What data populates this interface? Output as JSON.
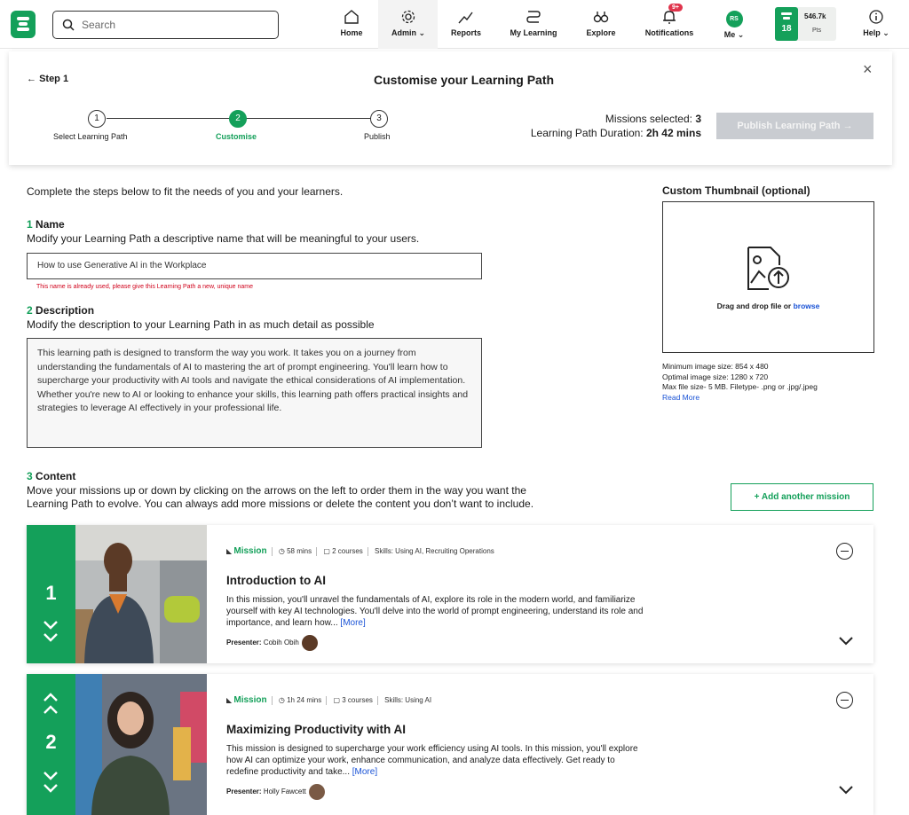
{
  "nav": {
    "search_placeholder": "Search",
    "items": [
      {
        "label": "Home"
      },
      {
        "label": "Admin"
      },
      {
        "label": "Reports"
      },
      {
        "label": "My Learning"
      },
      {
        "label": "Explore"
      },
      {
        "label": "Notifications"
      },
      {
        "label": "Me"
      },
      {
        "label": "Help"
      }
    ],
    "notifications_badge": "9+",
    "avatar_initials": "RS",
    "level": "18",
    "points": "546.7k",
    "points_label": "Pts"
  },
  "stepper": {
    "back_label": "Step 1",
    "title": "Customise your Learning Path",
    "steps": [
      {
        "num": "1",
        "label": "Select Learning Path"
      },
      {
        "num": "2",
        "label": "Customise"
      },
      {
        "num": "3",
        "label": "Publish"
      }
    ],
    "active_step": 2,
    "missions_selected_label": "Missions selected:",
    "missions_selected_value": "3",
    "duration_label": "Learning Path Duration:",
    "duration_value": "2h 42 mins",
    "publish_label": "Publish Learning Path",
    "close_glyph": "×"
  },
  "form": {
    "intro": "Complete the steps below to fit the needs of you and your learners.",
    "name": {
      "num": "1",
      "heading": "Name",
      "help": "Modify your Learning Path a descriptive name that will be meaningful to your users.",
      "value": "How to use Generative AI in the Workplace",
      "error": "This name is already used, please give this Learning Path a new, unique name"
    },
    "description": {
      "num": "2",
      "heading": "Description",
      "help": "Modify the description to your Learning Path in as much detail as possible",
      "value": "This learning path is designed to transform the way you work. It takes you on a journey from understanding the fundamentals of AI to mastering the art of prompt engineering. You'll learn how to supercharge your productivity with AI tools and navigate the ethical considerations of AI implementation. Whether you're new to AI or looking to enhance your skills, this learning path offers practical insights and strategies to leverage AI effectively in your professional life."
    },
    "content": {
      "num": "3",
      "heading": "Content",
      "help_line1": "Move your missions up or down by clicking on the arrows on the left to order them in the way you want the",
      "help_line2": "Learning Path to evolve. You can always add more missions or delete the content you don’t want to include.",
      "add_label": "+ Add another mission"
    }
  },
  "thumbnail": {
    "heading": "Custom Thumbnail (optional)",
    "drop_text": "Drag and drop file or ",
    "browse": "browse",
    "info": [
      "Minimum image size: 854 x 480",
      "Optimal image size: 1280 x 720",
      "Max file size- 5 MB. Filetype- .png or .jpg/.jpeg"
    ],
    "read_more": "Read More"
  },
  "missions": [
    {
      "order": "1",
      "tag": "Mission",
      "duration": "58 mins",
      "courses": "2 courses",
      "skills": "Skills: Using AI, Recruiting Operations",
      "title": "Introduction to AI",
      "desc": "In this mission, you'll unravel the fundamentals of AI, explore its role in the modern world, and familiarize yourself with key AI technologies. You'll delve into the world of prompt engineering, understand its role and importance, and learn how...",
      "more": "[More]",
      "presenter_label": "Presenter:",
      "presenter": "Cobih Obih"
    },
    {
      "order": "2",
      "tag": "Mission",
      "duration": "1h 24 mins",
      "courses": "3 courses",
      "skills": "Skills: Using AI",
      "title": "Maximizing Productivity with AI",
      "desc": "This mission is designed to supercharge your work efficiency using AI tools. In this mission, you'll explore how AI can optimize your work, enhance communication, and analyze data effectively. Get ready to redefine productivity and take...",
      "more": "[More]",
      "presenter_label": "Presenter:",
      "presenter": "Holly Fawcett"
    }
  ],
  "colors": {
    "accent": "#14a05a",
    "error": "#d0021b",
    "link": "#1a53d6",
    "disabled": "#c9ccd1"
  }
}
